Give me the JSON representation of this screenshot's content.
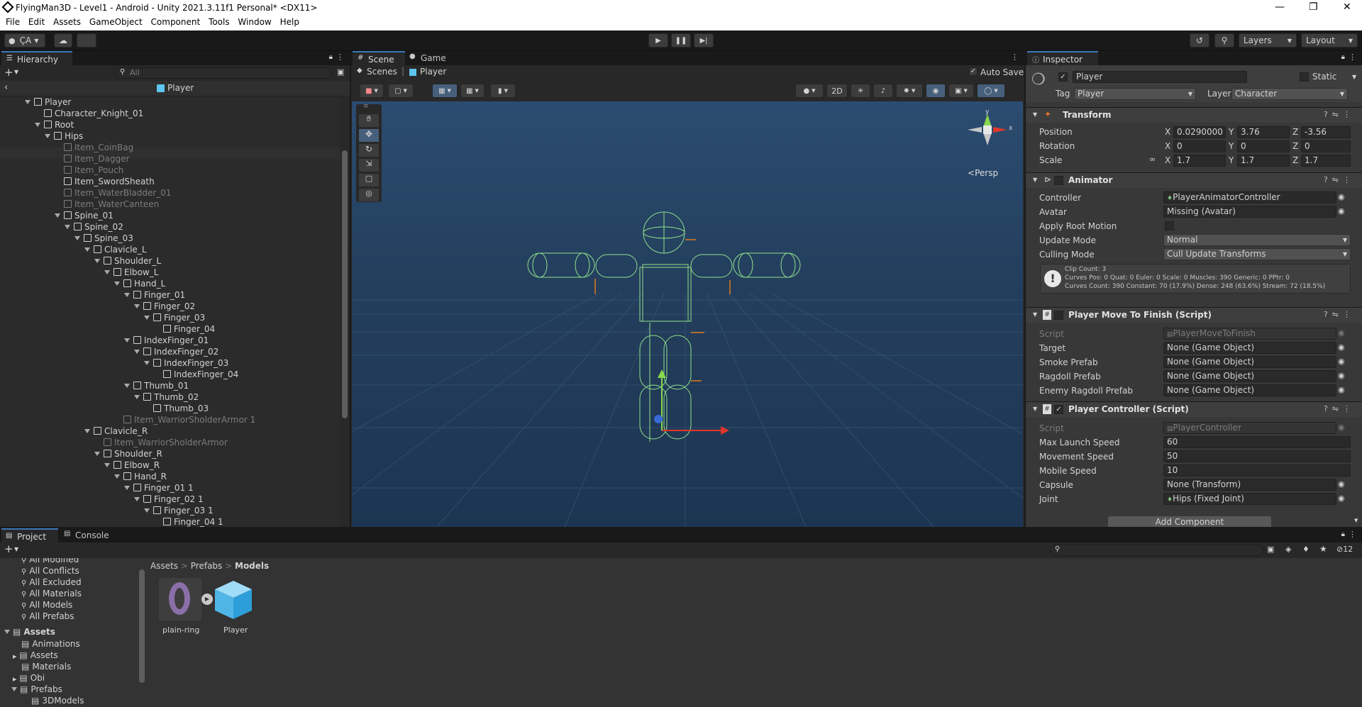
{
  "window": {
    "title": "FlyingMan3D - Level1 - Android - Unity 2021.3.11f1 Personal* <DX11>"
  },
  "menu": [
    "File",
    "Edit",
    "Assets",
    "GameObject",
    "Component",
    "Tools",
    "Window",
    "Help"
  ],
  "toolbar": {
    "account": "ÇA",
    "layers": "Layers",
    "layout": "Layout"
  },
  "hierarchy": {
    "tab": "Hierarchy",
    "search_placeholder": "All",
    "breadcrumb": "Player",
    "items": [
      {
        "label": "Player",
        "indent": 0,
        "arrow": true,
        "dim": false
      },
      {
        "label": "Character_Knight_01",
        "indent": 1,
        "arrow": false,
        "dim": false
      },
      {
        "label": "Root",
        "indent": 1,
        "arrow": true,
        "dim": false
      },
      {
        "label": "Hips",
        "indent": 2,
        "arrow": true,
        "dim": false
      },
      {
        "label": "Item_CoinBag",
        "indent": 3,
        "arrow": false,
        "dim": true
      },
      {
        "label": "Item_Dagger",
        "indent": 3,
        "arrow": false,
        "dim": true
      },
      {
        "label": "Item_Pouch",
        "indent": 3,
        "arrow": false,
        "dim": true
      },
      {
        "label": "Item_SwordSheath",
        "indent": 3,
        "arrow": false,
        "dim": false
      },
      {
        "label": "Item_WaterBladder_01",
        "indent": 3,
        "arrow": false,
        "dim": true
      },
      {
        "label": "Item_WaterCanteen",
        "indent": 3,
        "arrow": false,
        "dim": true
      },
      {
        "label": "Spine_01",
        "indent": 3,
        "arrow": true,
        "dim": false
      },
      {
        "label": "Spine_02",
        "indent": 4,
        "arrow": true,
        "dim": false
      },
      {
        "label": "Spine_03",
        "indent": 5,
        "arrow": true,
        "dim": false
      },
      {
        "label": "Clavicle_L",
        "indent": 6,
        "arrow": true,
        "dim": false
      },
      {
        "label": "Shoulder_L",
        "indent": 7,
        "arrow": true,
        "dim": false
      },
      {
        "label": "Elbow_L",
        "indent": 8,
        "arrow": true,
        "dim": false
      },
      {
        "label": "Hand_L",
        "indent": 9,
        "arrow": true,
        "dim": false
      },
      {
        "label": "Finger_01",
        "indent": 10,
        "arrow": true,
        "dim": false
      },
      {
        "label": "Finger_02",
        "indent": 11,
        "arrow": true,
        "dim": false
      },
      {
        "label": "Finger_03",
        "indent": 12,
        "arrow": true,
        "dim": false
      },
      {
        "label": "Finger_04",
        "indent": 13,
        "arrow": false,
        "dim": false
      },
      {
        "label": "IndexFinger_01",
        "indent": 10,
        "arrow": true,
        "dim": false
      },
      {
        "label": "IndexFinger_02",
        "indent": 11,
        "arrow": true,
        "dim": false
      },
      {
        "label": "IndexFinger_03",
        "indent": 12,
        "arrow": true,
        "dim": false
      },
      {
        "label": "IndexFinger_04",
        "indent": 13,
        "arrow": false,
        "dim": false
      },
      {
        "label": "Thumb_01",
        "indent": 10,
        "arrow": true,
        "dim": false
      },
      {
        "label": "Thumb_02",
        "indent": 11,
        "arrow": true,
        "dim": false
      },
      {
        "label": "Thumb_03",
        "indent": 12,
        "arrow": false,
        "dim": false
      },
      {
        "label": "Item_WarriorSholderArmor 1",
        "indent": 9,
        "arrow": false,
        "dim": true
      },
      {
        "label": "Clavicle_R",
        "indent": 6,
        "arrow": true,
        "dim": false
      },
      {
        "label": "Item_WarriorSholderArmor",
        "indent": 7,
        "arrow": false,
        "dim": true
      },
      {
        "label": "Shoulder_R",
        "indent": 7,
        "arrow": true,
        "dim": false
      },
      {
        "label": "Elbow_R",
        "indent": 8,
        "arrow": true,
        "dim": false
      },
      {
        "label": "Hand_R",
        "indent": 9,
        "arrow": true,
        "dim": false
      },
      {
        "label": "Finger_01 1",
        "indent": 10,
        "arrow": true,
        "dim": false
      },
      {
        "label": "Finger_02 1",
        "indent": 11,
        "arrow": true,
        "dim": false
      },
      {
        "label": "Finger_03 1",
        "indent": 12,
        "arrow": true,
        "dim": false
      },
      {
        "label": "Finger_04 1",
        "indent": 13,
        "arrow": false,
        "dim": false
      }
    ]
  },
  "scene": {
    "tabs": [
      "Scene",
      "Game"
    ],
    "breadcrumb_root": "Scenes",
    "breadcrumb_item": "Player",
    "auto_save": "Auto Save",
    "mode_2d": "2D",
    "persp": "Persp",
    "gizmo_y": "y",
    "gizmo_x": "x"
  },
  "inspector": {
    "tab": "Inspector",
    "object_name": "Player",
    "static_label": "Static",
    "tag_label": "Tag",
    "tag_value": "Player",
    "layer_label": "Layer",
    "layer_value": "Character",
    "transform": {
      "title": "Transform",
      "rows": [
        {
          "label": "Position",
          "x": "0.0290000",
          "y": "3.76",
          "z": "-3.56"
        },
        {
          "label": "Rotation",
          "x": "0",
          "y": "0",
          "z": "0"
        },
        {
          "label": "Scale",
          "x": "1.7",
          "y": "1.7",
          "z": "1.7"
        }
      ]
    },
    "animator": {
      "title": "Animator",
      "controller_label": "Controller",
      "controller_value": "PlayerAnimatorController",
      "avatar_label": "Avatar",
      "avatar_value": "Missing (Avatar)",
      "root_motion_label": "Apply Root Motion",
      "update_label": "Update Mode",
      "update_value": "Normal",
      "culling_label": "Culling Mode",
      "culling_value": "Cull Update Transforms",
      "info1": "Clip Count: 3",
      "info2": "Curves Pos: 0 Quat: 0 Euler: 0 Scale: 0 Muscles: 390 Generic: 0 PPtr: 0",
      "info3": "Curves Count: 390 Constant: 70 (17.9%) Dense: 248 (63.6%) Stream: 72 (18.5%)"
    },
    "move_to_finish": {
      "title": "Player Move To Finish (Script)",
      "rows": [
        {
          "label": "Script",
          "value": "PlayerMoveToFinish"
        },
        {
          "label": "Target",
          "value": "None (Game Object)"
        },
        {
          "label": "Smoke Prefab",
          "value": "None (Game Object)"
        },
        {
          "label": "Ragdoll Prefab",
          "value": "None (Game Object)"
        },
        {
          "label": "Enemy Ragdoll Prefab",
          "value": "None (Game Object)"
        }
      ]
    },
    "controller": {
      "title": "Player Controller (Script)",
      "rows": [
        {
          "label": "Script",
          "value": "PlayerController"
        },
        {
          "label": "Max Launch Speed",
          "value": "60"
        },
        {
          "label": "Movement Speed",
          "value": "50"
        },
        {
          "label": "Mobile Speed",
          "value": "10"
        },
        {
          "label": "Capsule",
          "value": "None (Transform)"
        },
        {
          "label": "Joint",
          "value": "Hips (Fixed Joint)"
        }
      ]
    },
    "add_component": "Add Component"
  },
  "project": {
    "tabs": [
      "Project",
      "Console"
    ],
    "favorites": [
      "All Modified",
      "All Conflicts",
      "All Excluded",
      "All Materials",
      "All Models",
      "All Prefabs"
    ],
    "tree_root": "Assets",
    "tree": [
      "Animations",
      "Assets",
      "Materials",
      "Obi",
      "Prefabs",
      "3DModels"
    ],
    "breadcrumb": [
      "Assets",
      "Prefabs",
      "Models"
    ],
    "assets": [
      "plain-ring",
      "Player"
    ],
    "hidden_count": "12"
  }
}
